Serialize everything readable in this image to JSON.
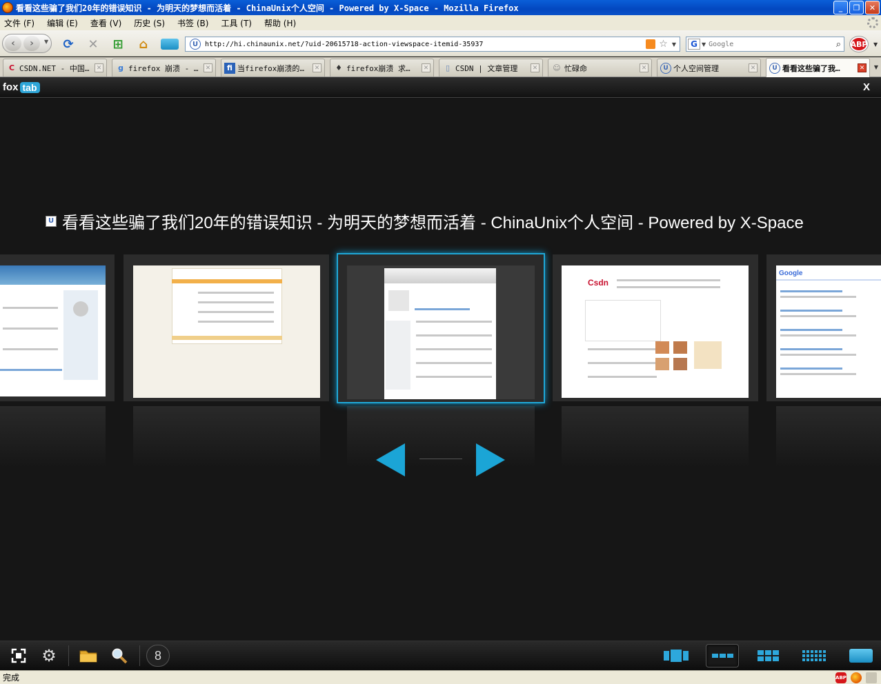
{
  "window": {
    "title": "看看这些骗了我们20年的错误知识 - 为明天的梦想而活着 - ChinaUnix个人空间 - Powered by X-Space - Mozilla Firefox",
    "buttons": [
      "_",
      "❐",
      "✕"
    ]
  },
  "menu": {
    "items": [
      "文件 (F)",
      "编辑 (E)",
      "查看 (V)",
      "历史 (S)",
      "书签 (B)",
      "工具 (T)",
      "帮助 (H)"
    ]
  },
  "navbar": {
    "url": "http://hi.chinaunix.net/?uid-20615718-action-viewspace-itemid-35937",
    "search_placeholder": "Google",
    "abp_label": "ABP"
  },
  "tabs": [
    {
      "label": "CSDN.NET - 中国…",
      "icon": "C",
      "color": "#c8102e"
    },
    {
      "label": "firefox 崩溃 - …",
      "icon": "g",
      "color": "#3a7bd5"
    },
    {
      "label": "当firefox崩溃的…",
      "icon": "fi",
      "color": "#2a62b8"
    },
    {
      "label": "firefox崩溃 求…",
      "icon": "♦",
      "color": "#333"
    },
    {
      "label": "CSDN | 文章管理",
      "icon": "▯",
      "color": "#6a88b8"
    },
    {
      "label": "忙碌命",
      "icon": "☺",
      "color": "#888"
    },
    {
      "label": "个人空间管理",
      "icon": "U",
      "color": "#3c68b6"
    },
    {
      "label": "看看这些骗了我…",
      "icon": "U",
      "color": "#3c68b6"
    }
  ],
  "foxtab": {
    "logo_part1": "fox",
    "logo_part2": "tab",
    "close_label": "X",
    "page_title": "看看这些骗了我们20年的错误知识 - 为明天的梦想而活着 - ChinaUnix个人空间 - Powered by X-Space",
    "tab_count": "8",
    "selected_view": "row"
  },
  "status": {
    "text": "完成"
  },
  "colors": {
    "accent": "#1ba5d6",
    "titlebar": "#0a52c8"
  }
}
